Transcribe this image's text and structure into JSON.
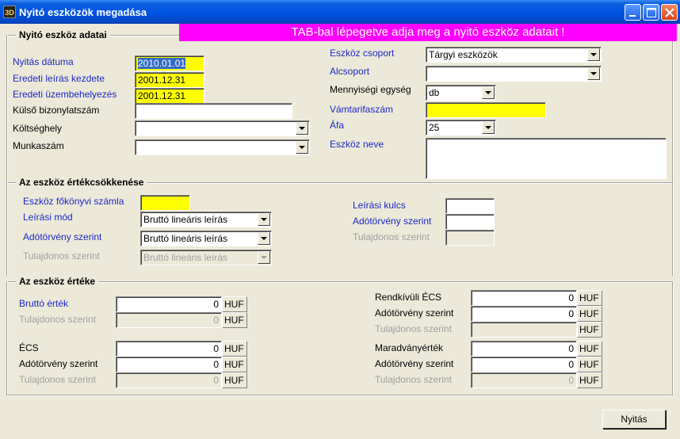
{
  "window": {
    "title": "Nyitó eszközök megadása",
    "app_icon_text": "3D"
  },
  "banner": "TAB-bal lépegetve adja meg a nyitó eszköz adatait !",
  "section1": {
    "title": "Nyitó eszköz adatai",
    "nyitas_datuma_label": "Nyitás dátuma",
    "nyitas_datuma_value": "2010.01.01",
    "eredeti_leiras_label": "Eredeti leírás kezdete",
    "eredeti_leiras_value": "2001.12.31",
    "eredeti_uzembe_label": "Eredeti üzembehelyezés",
    "eredeti_uzembe_value": "2001.12.31",
    "kulso_label": "Külső bizonylatszám",
    "kulso_value": "",
    "koltseghely_label": "Költséghely",
    "koltseghely_value": "",
    "munkaszam_label": "Munkaszám",
    "munkaszam_value": "",
    "eszkoz_csoport_label": "Eszköz csoport",
    "eszkoz_csoport_value": "Tárgyi eszközök",
    "alcsoport_label": "Alcsoport",
    "alcsoport_value": "",
    "mennyisegi_label": "Mennyiségi egység",
    "mennyisegi_value": "db",
    "vamtarifa_label": "Vámtarifaszám",
    "vamtarifa_value": "",
    "afa_label": "Áfa",
    "afa_value": "25",
    "eszkoz_neve_label": "Eszköz neve",
    "eszkoz_neve_value": ""
  },
  "section2": {
    "title": "Az eszköz értékcsökkenése",
    "fokonyvi_label": "Eszköz főkönyvi számla",
    "fokonyvi_value": "",
    "leirasi_mod_label": "Leírási mód",
    "leirasi_mod_value": "Bruttó lineáris leírás",
    "adotorveny_label": "Adótörvény szerint",
    "adotorveny_value": "Bruttó lineáris leírás",
    "tulajdonos_label": "Tulajdonos szerint",
    "tulajdonos_value": "Bruttó lineáris leírás",
    "leirasi_kulcs_label": "Leírási kulcs",
    "leirasi_kulcs_value": "",
    "adotorveny_kulcs_label": "Adótörvény szerint",
    "adotorveny_kulcs_value": "",
    "tulajdonos_kulcs_label": "Tulajdonos szerint",
    "tulajdonos_kulcs_value": ""
  },
  "section3": {
    "title": "Az eszköz értéke",
    "currency": "HUF",
    "brutto_label": "Bruttó érték",
    "brutto_value": "0",
    "brutto_tul_label": "Tulajdonos szerint",
    "brutto_tul_value": "0",
    "ecs_label": "ÉCS",
    "ecs_value": "0",
    "ecs_ado_label": "Adótörvény szerint",
    "ecs_ado_value": "0",
    "ecs_tul_label": "Tulajdonos szerint",
    "ecs_tul_value": "0",
    "rendkivuli_label": "Rendkívüli ÉCS",
    "rendkivuli_value": "0",
    "rendkivuli_ado_label": "Adótörvény szerint",
    "rendkivuli_ado_value": "0",
    "rendkivuli_tul_label": "Tulajdonos szerint",
    "rendkivuli_tul_value": "",
    "maradvany_label": "Maradványérték",
    "maradvany_value": "0",
    "maradvany_ado_label": "Adótörvény szerint",
    "maradvany_ado_value": "0",
    "maradvany_tul_label": "Tulajdonos szerint",
    "maradvany_tul_value": "0"
  },
  "buttons": {
    "nyitas": "Nyitás"
  }
}
